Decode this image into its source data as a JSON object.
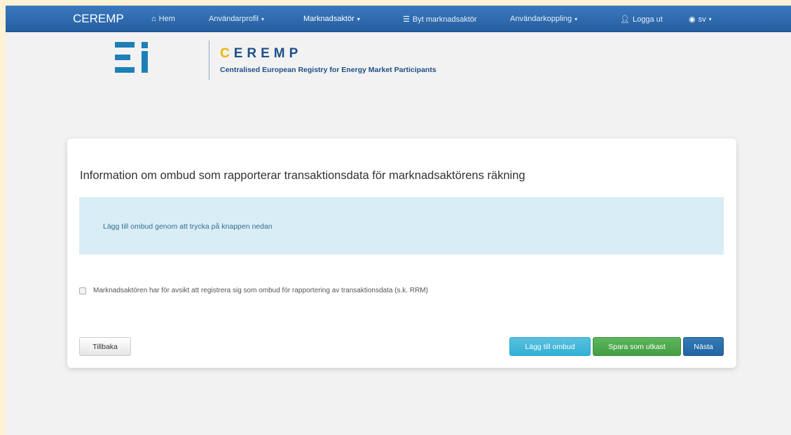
{
  "navbar": {
    "brand": "CEREMP",
    "items": [
      {
        "label": "Hem",
        "icon": "home-icon"
      },
      {
        "label": "Användarprofil",
        "icon": ""
      },
      {
        "label": "Marknadsaktör",
        "icon": ""
      },
      {
        "label": "Byt marknadsaktör",
        "icon": "list-icon"
      },
      {
        "label": "Användarkoppling",
        "icon": ""
      },
      {
        "label": "Logga ut",
        "icon": "user-icon"
      },
      {
        "label": "sv",
        "icon": "globe-icon"
      }
    ]
  },
  "logo": {
    "title": "CEREMP",
    "subtitle": "Centralised European Registry for Energy Market Participants"
  },
  "card": {
    "heading": "Information om ombud som rapporterar transaktionsdata för marknadsaktörens räkning",
    "info_text": "Lägg till ombud genom att trycka på knappen nedan",
    "checkbox_label": "Marknadsaktören har för avsikt att registrera sig som ombud för rapportering av transaktionsdata (s.k. RRM)",
    "checkbox_checked": false
  },
  "buttons": {
    "back": "Tillbaka",
    "add_agent": "Lägg till ombud",
    "save_draft": "Spara som utkast",
    "next": "Nästa"
  },
  "colors": {
    "navbar": "#2d6cb0",
    "info_bg": "#d9edf7",
    "btn_info": "#5bc0de",
    "btn_success": "#5cb85c",
    "btn_primary": "#337ab7"
  }
}
